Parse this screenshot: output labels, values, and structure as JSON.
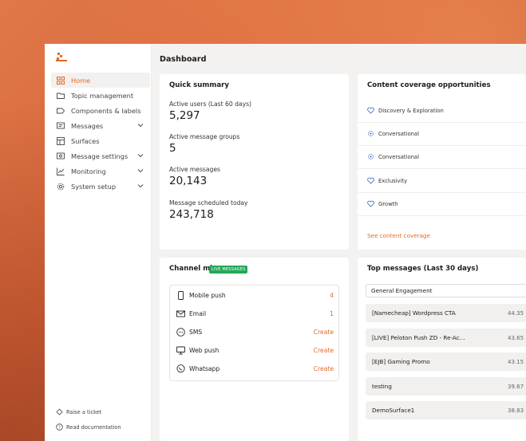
{
  "page": {
    "title": "Dashboard"
  },
  "colors": {
    "accent": "#e06a2a",
    "live_badge": "#25a85a"
  },
  "sidebar": {
    "items": [
      {
        "label": "Home",
        "icon": "grid-icon",
        "active": true
      },
      {
        "label": "Topic management",
        "icon": "folder-icon"
      },
      {
        "label": "Components & labels",
        "icon": "tag-icon"
      },
      {
        "label": "Messages",
        "icon": "message-icon",
        "expandable": true
      },
      {
        "label": "Surfaces",
        "icon": "layout-icon"
      },
      {
        "label": "Message settings",
        "icon": "message-settings-icon",
        "expandable": true
      },
      {
        "label": "Monitoring",
        "icon": "chart-line-icon",
        "expandable": true
      },
      {
        "label": "System setup",
        "icon": "gear-icon",
        "expandable": true
      }
    ],
    "footer": [
      {
        "label": "Raise a ticket",
        "icon": "ticket-icon"
      },
      {
        "label": "Read documentation",
        "icon": "help-icon"
      }
    ]
  },
  "quick_summary": {
    "title": "Quick summary",
    "stats": [
      {
        "label": "Active users (Last 60 days)",
        "value": "5,297"
      },
      {
        "label": "Active message groups",
        "value": "5"
      },
      {
        "label": "Active messages",
        "value": "20,143"
      },
      {
        "label": "Message scheduled today",
        "value": "243,718"
      }
    ]
  },
  "content_coverage": {
    "title": "Content coverage opportunities",
    "items": [
      {
        "label": "Discovery & Exploration",
        "icon": "heart-icon"
      },
      {
        "label": "Conversational",
        "icon": "sparkle-icon"
      },
      {
        "label": "Conversational",
        "icon": "sparkle-icon"
      },
      {
        "label": "Exclusivity",
        "icon": "heart-icon"
      },
      {
        "label": "Growth",
        "icon": "heart-icon"
      }
    ],
    "link": "See content coverage"
  },
  "channel_mix": {
    "title": "Channel mix",
    "badge": "LIVE MESSAGES",
    "rows": [
      {
        "label": "Mobile push",
        "icon": "phone-icon",
        "action": "4"
      },
      {
        "label": "Email",
        "icon": "mail-icon",
        "action": "1"
      },
      {
        "label": "SMS",
        "icon": "sms-icon",
        "action": "Create"
      },
      {
        "label": "Web push",
        "icon": "monitor-icon",
        "action": "Create"
      },
      {
        "label": "Whatsapp",
        "icon": "whatsapp-icon",
        "action": "Create"
      }
    ]
  },
  "top_messages": {
    "title": "Top messages (Last 30 days)",
    "filter": "General Engagement",
    "rows": [
      {
        "name": "[Namecheap] Wordpress CTA",
        "pct": "44.35"
      },
      {
        "name": "[LIVE] Peloton Push ZD - Re-Ac...",
        "pct": "43.65"
      },
      {
        "name": "[EJB] Gaming Promo",
        "pct": "43.15"
      },
      {
        "name": "testing",
        "pct": "39.67"
      },
      {
        "name": "DemoSurface1",
        "pct": "38.83"
      }
    ]
  }
}
